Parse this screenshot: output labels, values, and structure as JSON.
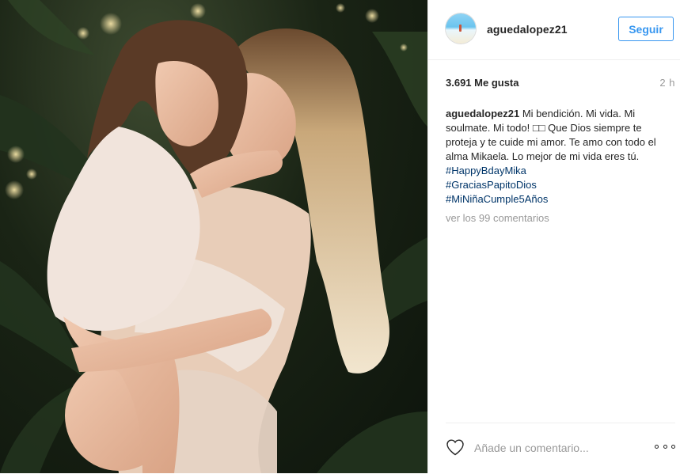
{
  "post": {
    "photo_alt": "",
    "author": {
      "username": "aguedalopez21",
      "follow_label": "Seguir"
    },
    "likes_text": "3.691 Me gusta",
    "time_ago": "2 h",
    "caption": {
      "username": "aguedalopez21",
      "text": "Mi bendición. Mi vida. Mi soulmate. Mi todo! □□ Que Dios siempre te proteja y te cuide mi amor. Te amo con todo el alma Mikaela. Lo mejor de mi vida eres tú.",
      "hashtags": [
        "#HappyBdayMika",
        "#GraciasPapitoDios",
        "#MiNiñaCumple5Años"
      ]
    },
    "view_comments_text": "ver los 99 comentarios",
    "comment_placeholder": "Añade un comentario...",
    "icons": {
      "like": "heart-outline-icon",
      "options": "more-options-icon"
    },
    "colors": {
      "accent": "#3897f0",
      "hashtag": "#003569",
      "muted": "#999999",
      "text": "#262626",
      "divider": "#efefef"
    }
  }
}
